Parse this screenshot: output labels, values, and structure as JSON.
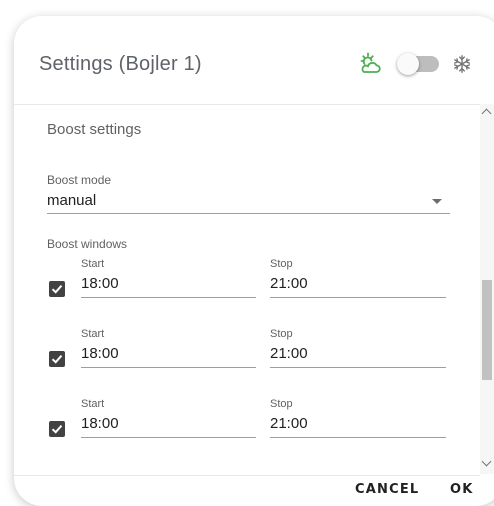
{
  "dialog": {
    "title": "Settings (Bojler 1)",
    "icons": {
      "left": "weather-partly-cloudy-icon",
      "right": "snowflake-icon"
    },
    "toggle": {
      "on": false
    },
    "accent_color": "#4caf50"
  },
  "section": {
    "title": "Boost settings",
    "mode_label": "Boost mode",
    "mode_value": "manual",
    "windows_label": "Boost windows",
    "windows": [
      {
        "enabled": true,
        "start_label": "Start",
        "start": "18:00",
        "stop_label": "Stop",
        "stop": "21:00"
      },
      {
        "enabled": true,
        "start_label": "Start",
        "start": "18:00",
        "stop_label": "Stop",
        "stop": "21:00"
      },
      {
        "enabled": true,
        "start_label": "Start",
        "start": "18:00",
        "stop_label": "Stop",
        "stop": "21:00"
      }
    ]
  },
  "footer": {
    "cancel_label": "CANCEL",
    "ok_label": "OK"
  }
}
